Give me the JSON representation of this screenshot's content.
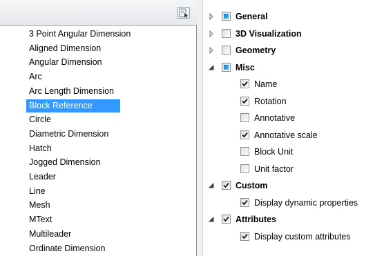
{
  "object_list": {
    "items": [
      {
        "label": "3 Point Angular Dimension",
        "selected": false
      },
      {
        "label": "Aligned Dimension",
        "selected": false
      },
      {
        "label": "Angular Dimension",
        "selected": false
      },
      {
        "label": "Arc",
        "selected": false
      },
      {
        "label": "Arc Length Dimension",
        "selected": false
      },
      {
        "label": "Block Reference",
        "selected": true
      },
      {
        "label": "Circle",
        "selected": false
      },
      {
        "label": "Diametric Dimension",
        "selected": false
      },
      {
        "label": "Hatch",
        "selected": false
      },
      {
        "label": "Jogged Dimension",
        "selected": false
      },
      {
        "label": "Leader",
        "selected": false
      },
      {
        "label": "Line",
        "selected": false
      },
      {
        "label": "Mesh",
        "selected": false
      },
      {
        "label": "MText",
        "selected": false
      },
      {
        "label": "Multileader",
        "selected": false
      },
      {
        "label": "Ordinate Dimension",
        "selected": false
      }
    ]
  },
  "property_tree": {
    "rows": [
      {
        "label": "General",
        "level": 0,
        "bold": true,
        "expander": "collapsed",
        "check": "indeterminate"
      },
      {
        "label": "3D Visualization",
        "level": 0,
        "bold": true,
        "expander": "collapsed",
        "check": "unchecked"
      },
      {
        "label": "Geometry",
        "level": 0,
        "bold": true,
        "expander": "collapsed",
        "check": "unchecked"
      },
      {
        "label": "Misc",
        "level": 0,
        "bold": true,
        "expander": "expanded",
        "check": "indeterminate"
      },
      {
        "label": "Name",
        "level": 1,
        "bold": false,
        "expander": "none",
        "check": "checked"
      },
      {
        "label": "Rotation",
        "level": 1,
        "bold": false,
        "expander": "none",
        "check": "checked"
      },
      {
        "label": "Annotative",
        "level": 1,
        "bold": false,
        "expander": "none",
        "check": "unchecked"
      },
      {
        "label": "Annotative scale",
        "level": 1,
        "bold": false,
        "expander": "none",
        "check": "checked"
      },
      {
        "label": "Block Unit",
        "level": 1,
        "bold": false,
        "expander": "none",
        "check": "unchecked"
      },
      {
        "label": "Unit factor",
        "level": 1,
        "bold": false,
        "expander": "none",
        "check": "unchecked"
      },
      {
        "label": "Custom",
        "level": 0,
        "bold": true,
        "expander": "expanded",
        "check": "checked"
      },
      {
        "label": "Display dynamic properties",
        "level": 1,
        "bold": false,
        "expander": "none",
        "check": "checked"
      },
      {
        "label": "Attributes",
        "level": 0,
        "bold": true,
        "expander": "expanded",
        "check": "checked"
      },
      {
        "label": "Display custom attributes",
        "level": 1,
        "bold": false,
        "expander": "none",
        "check": "checked"
      }
    ]
  },
  "icons": {
    "pick_button": "select-objects-icon",
    "collapsed": "triangle-right-icon",
    "expanded": "triangle-down-icon"
  },
  "colors": {
    "selection": "#3399ff",
    "indeterminate_fill": "#1a78c2",
    "check_mark": "#1a1a1a"
  }
}
